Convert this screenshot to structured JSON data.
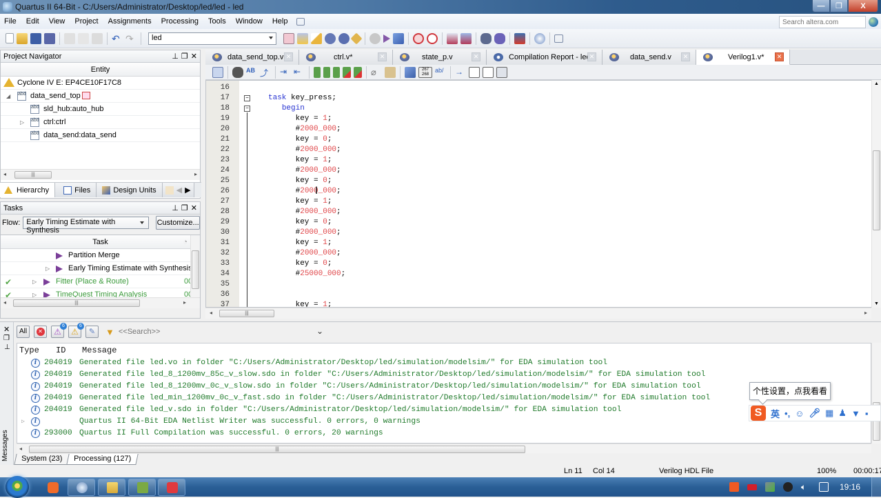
{
  "window": {
    "title": "Quartus II 64-Bit - C:/Users/Administrator/Desktop/led/led - led",
    "controls": {
      "minimize": "—",
      "restore": "❐",
      "close": "X"
    }
  },
  "menu": {
    "items": [
      "File",
      "Edit",
      "View",
      "Project",
      "Assignments",
      "Processing",
      "Tools",
      "Window",
      "Help"
    ],
    "search_placeholder": "Search altera.com"
  },
  "toolbar": {
    "project_selector": "led",
    "left_icons": [
      "new-file-icon",
      "open-folder-icon",
      "save-icon",
      "save-all-icon",
      "cut-icon",
      "copy-icon",
      "paste-icon",
      "undo-icon",
      "redo-icon"
    ],
    "right_icons": [
      "compilation-dashboard-icon",
      "pin-planner-icon",
      "analysis-icon",
      "analysis-synthesis-icon",
      "fitter-icon",
      "assembler-icon",
      "stop-icon",
      "start-compilation-icon",
      "start-analysis-icon",
      "timing-analyzer-icon",
      "timequest-icon",
      "rtl-viewer-icon",
      "technology-map-viewer-icon",
      "chip-planner-icon",
      "design-partition-icon",
      "programmer-icon",
      "help-icon",
      "feedback-icon"
    ]
  },
  "project_navigator": {
    "title": "Project Navigator",
    "column": "Entity",
    "device": "Cyclone IV E: EP4CE10F17C8",
    "tree": [
      {
        "label": "data_send_top",
        "level": 0,
        "expanded": true
      },
      {
        "label": "sld_hub:auto_hub",
        "level": 1,
        "expanded": null
      },
      {
        "label": "ctrl:ctrl",
        "level": 1,
        "expanded": false
      },
      {
        "label": "data_send:data_send",
        "level": 1,
        "expanded": null
      }
    ],
    "tabs": [
      "Hierarchy",
      "Files",
      "Design Units"
    ]
  },
  "tasks": {
    "title": "Tasks",
    "flow_label": "Flow:",
    "flow_value": "Early Timing Estimate with Synthesis",
    "customize_label": "Customize...",
    "column": "Task",
    "rows": [
      {
        "label": "Partition Merge",
        "done": false,
        "time": ""
      },
      {
        "label": "Early Timing Estimate with Synthesis",
        "done": false,
        "time": ""
      },
      {
        "label": "Fitter (Place & Route)",
        "done": true,
        "time": "00"
      },
      {
        "label": "TimeQuest Timing Analysis",
        "done": true,
        "time": "00"
      }
    ]
  },
  "editor": {
    "tabs": [
      {
        "label": "data_send_top.v",
        "active": false
      },
      {
        "label": "ctrl.v*",
        "active": false
      },
      {
        "label": "state_p.v",
        "active": false
      },
      {
        "label": "Compilation Report - led",
        "active": false
      },
      {
        "label": "data_send.v",
        "active": false
      },
      {
        "label": "Verilog1.v*",
        "active": true
      }
    ],
    "lines": [
      {
        "n": "16",
        "code": []
      },
      {
        "n": "17",
        "code": [
          [
            "kw",
            "task"
          ],
          [
            "t",
            " key_press;"
          ]
        ]
      },
      {
        "n": "18",
        "code": [
          [
            "t",
            "   "
          ],
          [
            "kw",
            "begin"
          ]
        ]
      },
      {
        "n": "19",
        "code": [
          [
            "t",
            "      key = "
          ],
          [
            "num",
            "1"
          ],
          [
            "t",
            ";"
          ]
        ]
      },
      {
        "n": "20",
        "code": [
          [
            "t",
            "      #"
          ],
          [
            "num",
            "2000_000"
          ],
          [
            "t",
            ";"
          ]
        ]
      },
      {
        "n": "21",
        "code": [
          [
            "t",
            "      key = "
          ],
          [
            "num",
            "0"
          ],
          [
            "t",
            ";"
          ]
        ]
      },
      {
        "n": "22",
        "code": [
          [
            "t",
            "      #"
          ],
          [
            "num",
            "2000_000"
          ],
          [
            "t",
            ";"
          ]
        ]
      },
      {
        "n": "23",
        "code": [
          [
            "t",
            "      key = "
          ],
          [
            "num",
            "1"
          ],
          [
            "t",
            ";"
          ]
        ]
      },
      {
        "n": "24",
        "code": [
          [
            "t",
            "      #"
          ],
          [
            "num",
            "2000_000"
          ],
          [
            "t",
            ";"
          ]
        ]
      },
      {
        "n": "25",
        "code": [
          [
            "t",
            "      key = "
          ],
          [
            "num",
            "0"
          ],
          [
            "t",
            ";"
          ]
        ]
      },
      {
        "n": "26",
        "code": [
          [
            "t",
            "      #"
          ],
          [
            "num",
            "2000_000"
          ],
          [
            "t",
            ";"
          ]
        ]
      },
      {
        "n": "27",
        "code": [
          [
            "t",
            "      key = "
          ],
          [
            "num",
            "1"
          ],
          [
            "t",
            ";"
          ]
        ]
      },
      {
        "n": "28",
        "code": [
          [
            "t",
            "      #"
          ],
          [
            "num",
            "2000_000"
          ],
          [
            "t",
            ";"
          ]
        ]
      },
      {
        "n": "29",
        "code": [
          [
            "t",
            "      key = "
          ],
          [
            "num",
            "0"
          ],
          [
            "t",
            ";"
          ]
        ]
      },
      {
        "n": "30",
        "code": [
          [
            "t",
            "      #"
          ],
          [
            "num",
            "2000_000"
          ],
          [
            "t",
            ";"
          ]
        ]
      },
      {
        "n": "31",
        "code": [
          [
            "t",
            "      key = "
          ],
          [
            "num",
            "1"
          ],
          [
            "t",
            ";"
          ]
        ]
      },
      {
        "n": "32",
        "code": [
          [
            "t",
            "      #"
          ],
          [
            "num",
            "2000_000"
          ],
          [
            "t",
            ";"
          ]
        ]
      },
      {
        "n": "33",
        "code": [
          [
            "t",
            "      key = "
          ],
          [
            "num",
            "0"
          ],
          [
            "t",
            ";"
          ]
        ]
      },
      {
        "n": "34",
        "code": [
          [
            "t",
            "      #"
          ],
          [
            "num",
            "25000_000"
          ],
          [
            "t",
            ";"
          ]
        ]
      },
      {
        "n": "35",
        "code": []
      },
      {
        "n": "36",
        "code": []
      },
      {
        "n": "37",
        "code": [
          [
            "t",
            "      key = "
          ],
          [
            "num",
            "1"
          ],
          [
            "t",
            ";"
          ]
        ]
      }
    ]
  },
  "messages": {
    "side_label": "Messages",
    "filters": {
      "all": "All",
      "warning_count": "6",
      "critical_count": "6"
    },
    "search_placeholder": "<<Search>>",
    "columns": [
      "Type",
      "ID",
      "Message"
    ],
    "rows": [
      {
        "id": "204019",
        "text": "Generated file led.vo in folder \"C:/Users/Administrator/Desktop/led/simulation/modelsim/\" for EDA simulation tool",
        "expandable": false
      },
      {
        "id": "204019",
        "text": "Generated file led_8_1200mv_85c_v_slow.sdo in folder \"C:/Users/Administrator/Desktop/led/simulation/modelsim/\" for EDA simulation tool",
        "expandable": false
      },
      {
        "id": "204019",
        "text": "Generated file led_8_1200mv_0c_v_slow.sdo in folder \"C:/Users/Administrator/Desktop/led/simulation/modelsim/\" for EDA simulation tool",
        "expandable": false
      },
      {
        "id": "204019",
        "text": "Generated file led_min_1200mv_0c_v_fast.sdo in folder \"C:/Users/Administrator/Desktop/led/simulation/modelsim/\" for EDA simulation tool",
        "expandable": false
      },
      {
        "id": "204019",
        "text": "Generated file led_v.sdo in folder \"C:/Users/Administrator/Desktop/led/simulation/modelsim/\" for EDA simulation tool",
        "expandable": false
      },
      {
        "id": "",
        "text": "Quartus II 64-Bit EDA Netlist Writer was successful. 0 errors, 0 warnings",
        "expandable": true
      },
      {
        "id": "293000",
        "text": "Quartus II Full Compilation was successful. 0 errors, 20 warnings",
        "expandable": false
      }
    ],
    "tabs": [
      {
        "label": "System (23)",
        "active": false
      },
      {
        "label": "Processing (127)",
        "active": true
      }
    ]
  },
  "status": {
    "line": "Ln 11",
    "col": "Col 14",
    "file_type": "Verilog HDL File",
    "progress": "100%",
    "elapsed": "00:00:17"
  },
  "ime": {
    "tooltip": "个性设置，点我看看",
    "mode": "英",
    "punct": "•,"
  },
  "taskbar": {
    "clock": "19:16",
    "apps": [
      "uc-browser",
      "quartus",
      "file-explorer",
      "terminal",
      "media-recorder"
    ]
  },
  "colors": {
    "keyword": "#2632d1",
    "number": "#e0474a",
    "message_text": "#1f7a2a",
    "task_done_text": "#3a9a3a",
    "play_icon": "#7b3f99"
  }
}
